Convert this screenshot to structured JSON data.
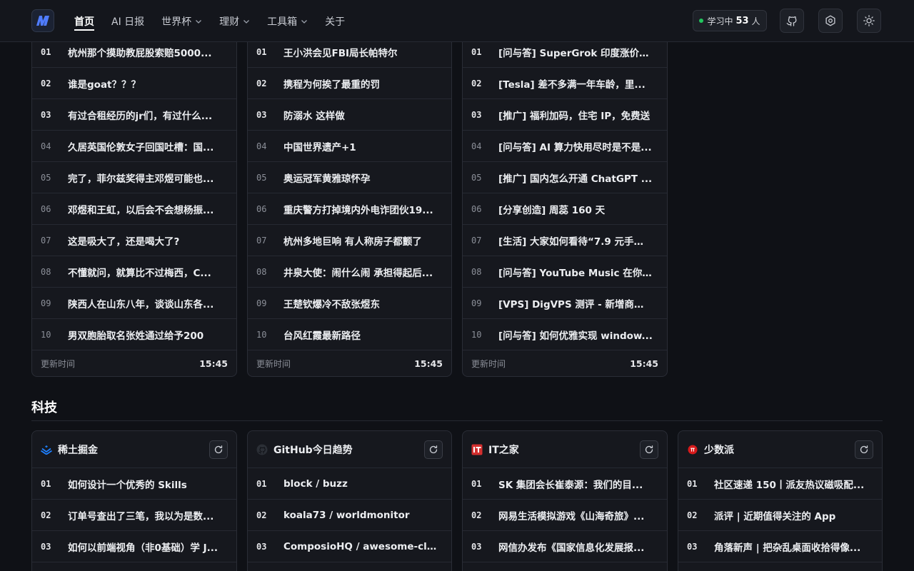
{
  "nav": {
    "items": [
      {
        "label": "首页",
        "active": true,
        "dropdown": false
      },
      {
        "label": "AI 日报",
        "active": false,
        "dropdown": false
      },
      {
        "label": "世界杯",
        "active": false,
        "dropdown": true
      },
      {
        "label": "理财",
        "active": false,
        "dropdown": true
      },
      {
        "label": "工具箱",
        "active": false,
        "dropdown": true
      },
      {
        "label": "关于",
        "active": false,
        "dropdown": false
      }
    ]
  },
  "status": {
    "prefix": "学习中",
    "count": "53",
    "suffix": "人",
    "dot_color": "#22c55e"
  },
  "header_icons": [
    "github-icon",
    "settings-icon",
    "sun-icon"
  ],
  "top_cards": [
    {
      "items": [
        {
          "idx": "01",
          "title": "杭州那个摸助教屁股索赔5000..."
        },
        {
          "idx": "02",
          "title": "谁是goat？？？"
        },
        {
          "idx": "03",
          "title": "有过合租经历的jr们，有过什么..."
        },
        {
          "idx": "04",
          "title": "久居英国伦敦女子回国吐槽：国..."
        },
        {
          "idx": "05",
          "title": "完了，菲尔兹奖得主邓煜可能也..."
        },
        {
          "idx": "06",
          "title": "邓煜和王虹，以后会不会想杨振..."
        },
        {
          "idx": "07",
          "title": "这是吸大了，还是喝大了?"
        },
        {
          "idx": "08",
          "title": "不懂就问，就算比不过梅西，C..."
        },
        {
          "idx": "09",
          "title": "陕西人在山东八年，谈谈山东各..."
        },
        {
          "idx": "10",
          "title": "男双胞胎取名张姓通过给予200"
        }
      ],
      "footer_label": "更新时间",
      "footer_time": "15:45"
    },
    {
      "items": [
        {
          "idx": "01",
          "title": "王小洪会见FBI局长帕特尔"
        },
        {
          "idx": "02",
          "title": "携程为何挨了最重的罚"
        },
        {
          "idx": "03",
          "title": "防溺水 这样做"
        },
        {
          "idx": "04",
          "title": "中国世界遗产+1"
        },
        {
          "idx": "05",
          "title": "奥运冠军黄雅琼怀孕"
        },
        {
          "idx": "06",
          "title": "重庆警方打掉境内外电诈团伙19..."
        },
        {
          "idx": "07",
          "title": "杭州多地巨响 有人称房子都颤了"
        },
        {
          "idx": "08",
          "title": "井泉大使：闹什么闹 承担得起后..."
        },
        {
          "idx": "09",
          "title": "王楚钦爆冷不敌张煜东"
        },
        {
          "idx": "10",
          "title": "台风红霞最新路径"
        }
      ],
      "footer_label": "更新时间",
      "footer_time": "15:45"
    },
    {
      "items": [
        {
          "idx": "01",
          "title": "[问与答] SuperGrok 印度涨价：..."
        },
        {
          "idx": "02",
          "title": "[Tesla] 差不多满一年车龄，里..."
        },
        {
          "idx": "03",
          "title": "[推广] 福利加码，住宅 IP，免费送"
        },
        {
          "idx": "04",
          "title": "[问与答] AI 算力快用尽时是不是..."
        },
        {
          "idx": "05",
          "title": "[推广] 国内怎么开通 ChatGPT ..."
        },
        {
          "idx": "06",
          "title": "[分享创造] 周蕊 160 天"
        },
        {
          "idx": "07",
          "title": "[生活] 大家如何看待“7.9 元手机..."
        },
        {
          "idx": "08",
          "title": "[问与答] YouTube Music 在你..."
        },
        {
          "idx": "09",
          "title": "[VPS] DigVPS 测评 - 新增商户 ..."
        },
        {
          "idx": "10",
          "title": "[问与答] 如何优雅实现 window..."
        }
      ],
      "footer_label": "更新时间",
      "footer_time": "15:45"
    }
  ],
  "section": {
    "title": "科技"
  },
  "tech_cards": [
    {
      "name": "稀土掘金",
      "icon": "juejin-icon",
      "icon_color": "#1e80ff",
      "items": [
        {
          "idx": "01",
          "title": "如何设计一个优秀的 Skills"
        },
        {
          "idx": "02",
          "title": "订单号查出了三笔，我以为是数..."
        },
        {
          "idx": "03",
          "title": "如何以前端视角（非0基础）学 J..."
        }
      ]
    },
    {
      "name": "GitHub今日趋势",
      "icon": "github-icon",
      "icon_color": "#2b2f36",
      "items": [
        {
          "idx": "01",
          "title": "block / buzz"
        },
        {
          "idx": "02",
          "title": "koala73 / worldmonitor"
        },
        {
          "idx": "03",
          "title": "ComposioHQ / awesome-clau..."
        }
      ]
    },
    {
      "name": "IT之家",
      "icon": "ithome-icon",
      "icon_color": "#d32f2f",
      "items": [
        {
          "idx": "01",
          "title": "SK 集团会长崔泰源：我们的目..."
        },
        {
          "idx": "02",
          "title": "网易生活模拟游戏《山海奇旅》..."
        },
        {
          "idx": "03",
          "title": "网信办发布《国家信息化发展报..."
        }
      ]
    },
    {
      "name": "少数派",
      "icon": "sspai-icon",
      "icon_color": "#d71a1b",
      "items": [
        {
          "idx": "01",
          "title": "社区速递 150丨派友热议磁吸配..."
        },
        {
          "idx": "02",
          "title": "派评 | 近期值得关注的 App"
        },
        {
          "idx": "03",
          "title": "角落新声 | 把杂乱桌面收拾得像..."
        }
      ]
    }
  ]
}
